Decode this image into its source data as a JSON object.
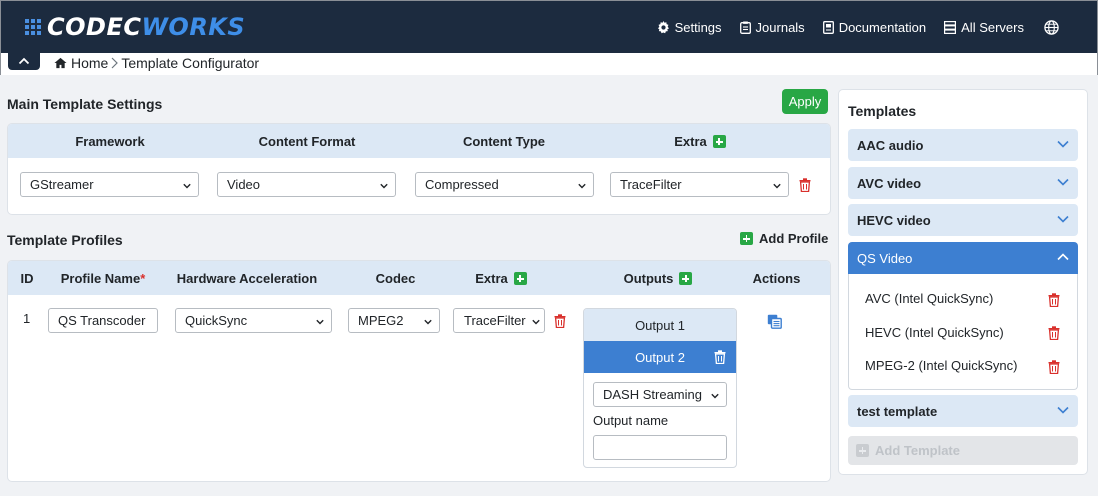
{
  "brand": {
    "part1": "CODEC",
    "part2": "WORKS"
  },
  "nav": {
    "settings": "Settings",
    "journals": "Journals",
    "documentation": "Documentation",
    "all_servers": "All Servers"
  },
  "breadcrumb": {
    "home": "Home",
    "current": "Template Configurator"
  },
  "main_settings": {
    "title": "Main Template Settings",
    "apply_label": "Apply",
    "headers": {
      "framework": "Framework",
      "content_format": "Content Format",
      "content_type": "Content Type",
      "extra": "Extra"
    },
    "values": {
      "framework": "GStreamer",
      "content_format": "Video",
      "content_type": "Compressed",
      "extra": "TraceFilter"
    }
  },
  "profiles": {
    "title": "Template Profiles",
    "add_label": "Add Profile",
    "headers": {
      "id": "ID",
      "profile_name": "Profile Name",
      "required_mark": "*",
      "hw_accel": "Hardware Acceleration",
      "codec": "Codec",
      "extra": "Extra",
      "outputs": "Outputs",
      "actions": "Actions"
    },
    "rows": [
      {
        "id": "1",
        "profile_name": "QS Transcoder",
        "hw_accel": "QuickSync",
        "codec": "MPEG2",
        "extra": "TraceFilter",
        "outputs": [
          {
            "label": "Output 1"
          },
          {
            "label": "Output 2",
            "type": "DASH Streaming",
            "name_label": "Output name",
            "name_value": ""
          }
        ]
      }
    ]
  },
  "templates": {
    "title": "Templates",
    "items": [
      {
        "label": "AAC audio",
        "open": false
      },
      {
        "label": "AVC video",
        "open": false
      },
      {
        "label": "HEVC video",
        "open": false
      },
      {
        "label": "QS Video",
        "open": true,
        "children": [
          "AVC (Intel QuickSync)",
          "HEVC (Intel QuickSync)",
          "MPEG-2 (Intel QuickSync)"
        ]
      },
      {
        "label": "test template",
        "open": false
      }
    ],
    "add_label": "Add Template"
  },
  "colors": {
    "navbar": "#1c2b3f",
    "accent": "#3d7fd1",
    "success": "#28a745",
    "danger": "#d9302c",
    "header_bg": "#dce8f5"
  }
}
